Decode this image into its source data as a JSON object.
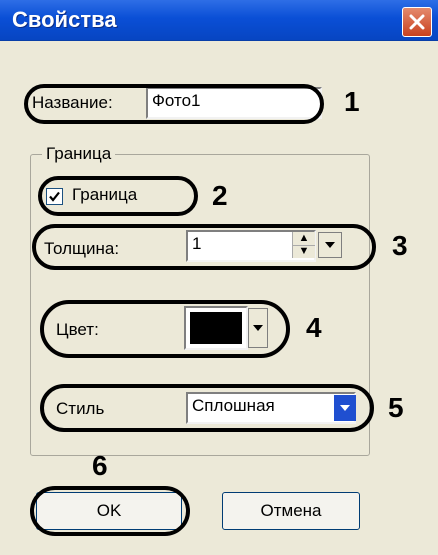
{
  "window": {
    "title": "Свойства"
  },
  "name_field": {
    "label": "Название:",
    "value": "Фото1"
  },
  "border_group": {
    "legend": "Граница",
    "checkbox_label": "Граница",
    "checkbox_checked": true,
    "thickness_label": "Толщина:",
    "thickness_value": "1",
    "color_label": "Цвет:",
    "color_value": "#000000",
    "style_label": "Стиль",
    "style_value": "Сплошная"
  },
  "buttons": {
    "ok": "OK",
    "cancel": "Отмена"
  },
  "callouts": [
    "1",
    "2",
    "3",
    "4",
    "5",
    "6"
  ],
  "icons": {
    "close": "close-icon",
    "checkmark": "checkmark-icon",
    "spin_up": "arrow-up-icon",
    "spin_down": "arrow-down-icon",
    "dropdown": "chevron-down-icon"
  }
}
